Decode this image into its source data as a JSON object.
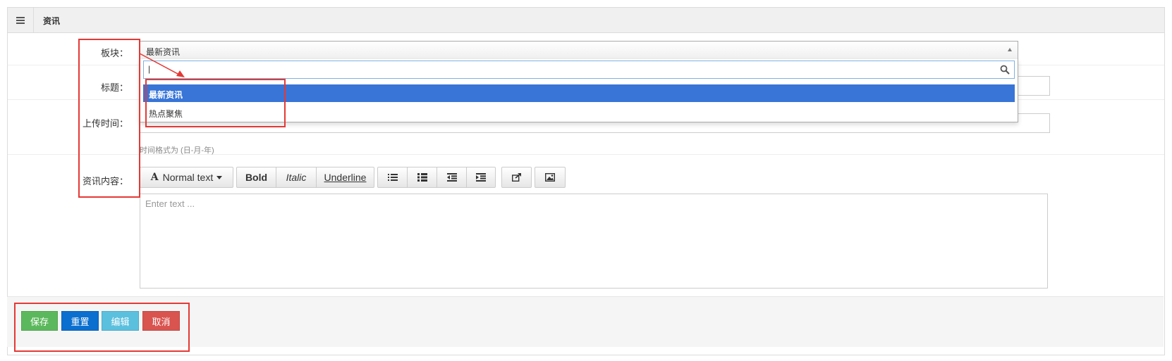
{
  "header": {
    "title": "资讯",
    "menu_icon": "hamburger-icon"
  },
  "form": {
    "section_label": "板块：",
    "section_value": "最新资讯",
    "title_label": "标题：",
    "upload_time_label": "上传时间：",
    "time_help": "时间格式为 (日-月-年)",
    "content_label": "资讯内容："
  },
  "dropdown": {
    "search_value": "|",
    "options": [
      {
        "label": "最新资讯",
        "selected": true
      },
      {
        "label": "热点聚焦",
        "selected": false
      }
    ]
  },
  "editor": {
    "font_style_label": "Normal text",
    "font_icon": "A",
    "bold_label": "Bold",
    "italic_label": "Italic",
    "underline_label": "Underline",
    "placeholder": "Enter text ..."
  },
  "footer": {
    "save_label": "保存",
    "reset_label": "重置",
    "edit_label": "编辑",
    "cancel_label": "取消"
  },
  "colors": {
    "save": "#5cb85c",
    "reset": "#0b6fcf",
    "edit": "#5bc0de",
    "cancel": "#d9534f",
    "selected_option": "#3875d7",
    "annotation": "#e53935"
  }
}
